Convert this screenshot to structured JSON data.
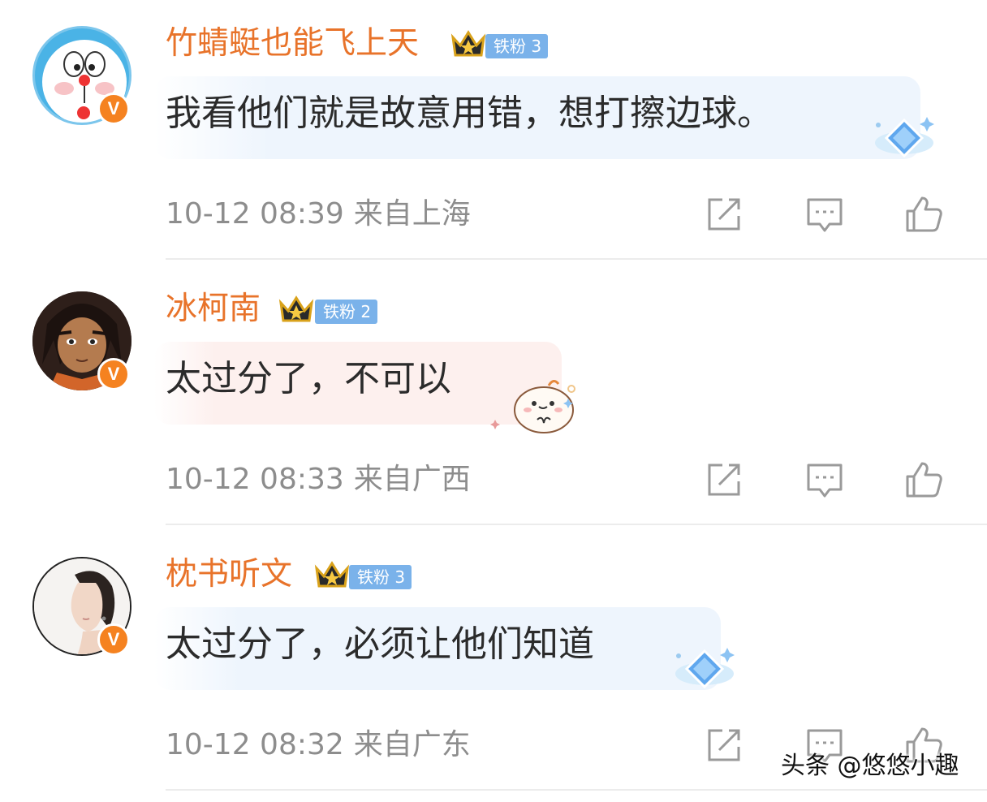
{
  "comments": [
    {
      "nickname": "竹蜻蜓也能飞上天",
      "fan_badge": "铁粉 3",
      "verified_mark": "V",
      "text": "我看他们就是故意用错，想打擦边球。",
      "time": "10-12 08:39",
      "location": "来自上海",
      "avatar": "doraemon-avatar",
      "decoration": "diamond-sticker"
    },
    {
      "nickname": "冰柯南",
      "fan_badge": "铁粉 2",
      "verified_mark": "V",
      "text": "太过分了，不可以",
      "time": "10-12 08:33",
      "location": "来自广西",
      "avatar": "anime-boy-avatar",
      "decoration": "cute-bun-sticker"
    },
    {
      "nickname": "枕书听文",
      "fan_badge": "铁粉 3",
      "verified_mark": "V",
      "text": "太过分了，必须让他们知道",
      "time": "10-12 08:32",
      "location": "来自广东",
      "avatar": "woman-portrait-avatar",
      "decoration": "diamond-sticker"
    }
  ],
  "actions": [
    "share-icon",
    "reply-icon",
    "like-icon"
  ],
  "watermark": "头条 @悠悠小趣",
  "colors": {
    "nickname": "#e8732a",
    "text": "#2b2b2b",
    "meta": "#8d8d8d",
    "fan_badge": "#7ab2ea",
    "verified": "#f58220",
    "icon": "#9a9a9a"
  }
}
